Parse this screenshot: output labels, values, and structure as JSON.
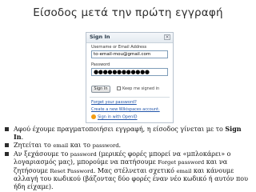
{
  "slide": {
    "title": "Είσοδος μετά την πρώτη εγγραφή"
  },
  "screenshot": {
    "header_title": "Sign In",
    "close_glyph": "×",
    "username_label": "Username or Email Address",
    "username_value": "to-email-mou@gmail.com",
    "password_label": "Password",
    "password_value": "●●●●●●●●●●●●",
    "signin_button": "Sign In",
    "keep_signed_in": "Keep me signed in",
    "links": {
      "forgot_password": "Forget your password?",
      "create_workspace": "Create a new Wikispaces account.",
      "openid": "Sign in with OpenID"
    },
    "icons": {
      "openid": "openid-icon",
      "close": "close-icon"
    }
  },
  "bullets": [
    {
      "a": "Αφού έχουμε πραγματοποιήσει εγγραφή, η είσοδος γίνεται με το ",
      "b": "Sign In",
      "c": "."
    },
    {
      "a": "Ζητείται το ",
      "b": "email",
      "c": " και το ",
      "d": "password",
      "e": "."
    },
    {
      "a": "Αν ξεχάσουμε το ",
      "b": "password",
      "c": " (μερικές φορές μπορεί να «μπλοκάρει» ο λογαριασμός μας), μπορούμε να πατήσουμε ",
      "d": "Forget password",
      "e": " και να ζητήσουμε ",
      "f": "Reset Password",
      "g": ". Μας στέλνεται σχετικό ",
      "h": "email",
      "i": " και κάνουμε αλλαγή του κωδικού (βάζοντας δύο φορές έναν νέο κωδικό ή αυτόν που ήδη είχαμε)."
    }
  ],
  "colors": {
    "accent": "#2255aa",
    "bullet": "#2c2c2c"
  }
}
